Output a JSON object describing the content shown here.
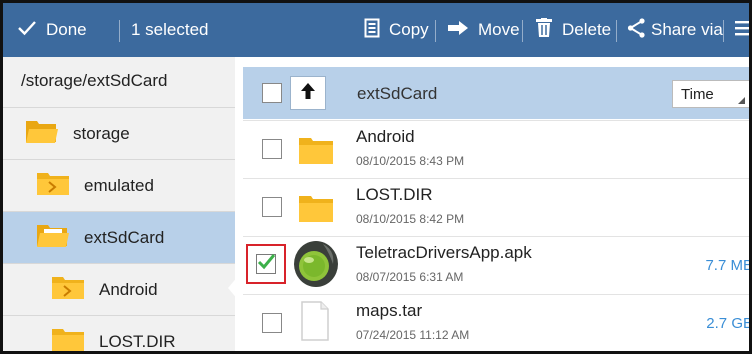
{
  "actionbar": {
    "done_label": "Done",
    "selected_label": "1 selected",
    "copy_label": "Copy",
    "move_label": "Move",
    "delete_label": "Delete",
    "share_label": "Share via",
    "background_color": "#3c6a9e"
  },
  "tree": {
    "path": "/storage/extSdCard",
    "items": [
      {
        "label": "storage",
        "icon": "folder-open-icon"
      },
      {
        "label": "emulated",
        "icon": "folder-collapsed-icon"
      },
      {
        "label": "extSdCard",
        "icon": "folder-open-icon",
        "selected": true
      },
      {
        "label": "Android",
        "icon": "folder-collapsed-icon"
      },
      {
        "label": "LOST.DIR",
        "icon": "folder-icon"
      }
    ],
    "selected_color": "#b8d0e9"
  },
  "list": {
    "header_title": "extSdCard",
    "sort_value": "Time",
    "files": [
      {
        "name": "Android",
        "date": "08/10/2015 8:43 PM",
        "size": "",
        "type": "folder",
        "checked": false
      },
      {
        "name": "LOST.DIR",
        "date": "08/10/2015 8:42 PM",
        "size": "",
        "type": "folder",
        "checked": false
      },
      {
        "name": "TeletracDriversApp.apk",
        "date": "08/07/2015 6:31 AM",
        "size": "7.7 MB",
        "type": "apk",
        "checked": true
      },
      {
        "name": "maps.tar",
        "date": "07/24/2015 11:12 AM",
        "size": "2.7 GB",
        "type": "file",
        "checked": false
      }
    ],
    "size_color": "#3a8ed6",
    "highlight_color": "#d8232a"
  }
}
